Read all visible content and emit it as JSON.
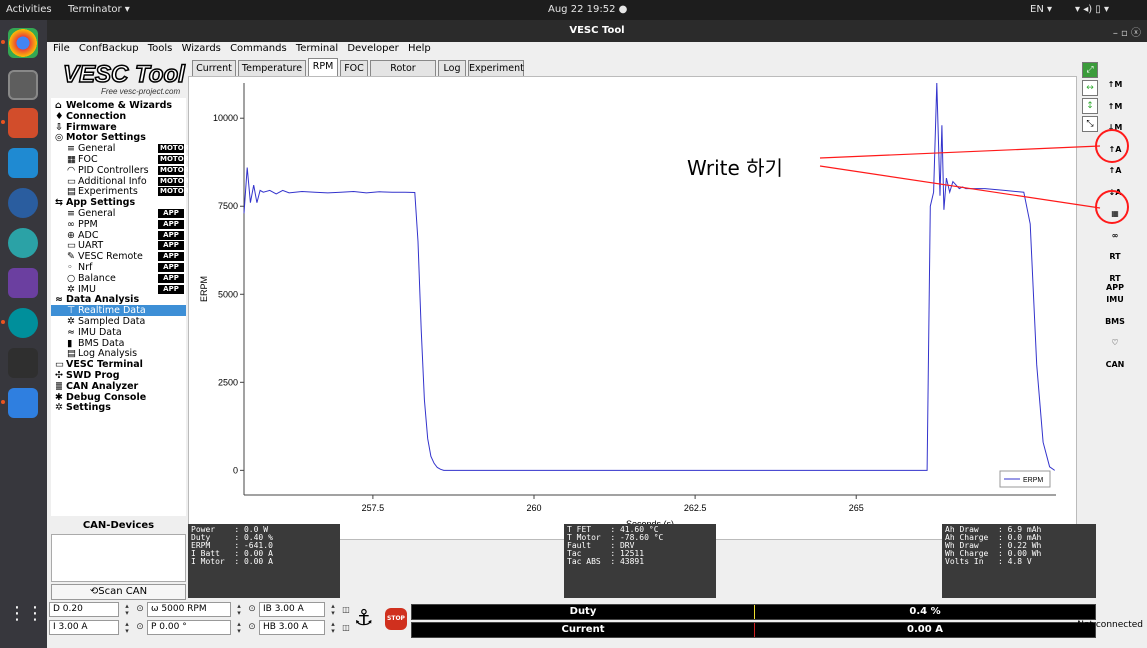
{
  "topbar": {
    "activities": "Activities",
    "app": "Terminator ▾",
    "clock": "Aug 22  19:52  ●",
    "lang": "EN ▾",
    "tray": "▾ ◂) ▯ ▾"
  },
  "window": {
    "title": "VESC Tool",
    "controls": "– ▫ ⓧ"
  },
  "menu": [
    "File",
    "ConfBackup",
    "Tools",
    "Wizards",
    "Commands",
    "Terminal",
    "Developer",
    "Help"
  ],
  "logo": {
    "brand": "VESC Tool",
    "sub": "Free  vesc-project.com"
  },
  "tree": [
    {
      "label": "Welcome & Wizards",
      "icon": "⌂",
      "head": true
    },
    {
      "label": "Connection",
      "icon": "♦",
      "head": true
    },
    {
      "label": "Firmware",
      "icon": "⇩",
      "head": true
    },
    {
      "label": "Motor Settings",
      "icon": "◎",
      "head": true
    },
    {
      "label": "General",
      "icon": "≡",
      "badge": "MOTOR",
      "sub": true
    },
    {
      "label": "FOC",
      "icon": "▦",
      "badge": "MOTOR",
      "sub": true
    },
    {
      "label": "PID Controllers",
      "icon": "◠",
      "badge": "MOTOR",
      "sub": true
    },
    {
      "label": "Additional Info",
      "icon": "▭",
      "badge": "MOTOR",
      "sub": true
    },
    {
      "label": "Experiments",
      "icon": "▤",
      "badge": "MOTOR",
      "sub": true
    },
    {
      "label": "App Settings",
      "icon": "⇆",
      "head": true
    },
    {
      "label": "General",
      "icon": "≡",
      "badge": "APP",
      "sub": true
    },
    {
      "label": "PPM",
      "icon": "∞",
      "badge": "APP",
      "sub": true
    },
    {
      "label": "ADC",
      "icon": "⊕",
      "badge": "APP",
      "sub": true
    },
    {
      "label": "UART",
      "icon": "▭",
      "badge": "APP",
      "sub": true
    },
    {
      "label": "VESC Remote",
      "icon": "✎",
      "badge": "APP",
      "sub": true
    },
    {
      "label": "Nrf",
      "icon": "◦",
      "badge": "APP",
      "sub": true
    },
    {
      "label": "Balance",
      "icon": "○",
      "badge": "APP",
      "sub": true
    },
    {
      "label": "IMU",
      "icon": "✲",
      "badge": "APP",
      "sub": true
    },
    {
      "label": "Data Analysis",
      "icon": "≈",
      "head": true
    },
    {
      "label": "Realtime Data",
      "icon": "⊤",
      "sub": true,
      "selected": true
    },
    {
      "label": "Sampled Data",
      "icon": "✲",
      "sub": true
    },
    {
      "label": "IMU Data",
      "icon": "≈",
      "sub": true
    },
    {
      "label": "BMS Data",
      "icon": "▮",
      "sub": true
    },
    {
      "label": "Log Analysis",
      "icon": "▤",
      "sub": true
    },
    {
      "label": "VESC Terminal",
      "icon": "▭",
      "head": true
    },
    {
      "label": "SWD Prog",
      "icon": "✣",
      "head": true
    },
    {
      "label": "CAN Analyzer",
      "icon": "≣",
      "head": true
    },
    {
      "label": "Debug Console",
      "icon": "✱",
      "head": true
    },
    {
      "label": "Settings",
      "icon": "✲",
      "head": true
    }
  ],
  "can": {
    "title": "CAN-Devices",
    "scan": "⟲Scan CAN"
  },
  "tabs": [
    "Current",
    "Temperature",
    "RPM",
    "FOC",
    "Rotor Position",
    "Log",
    "Experiment"
  ],
  "active_tab": "RPM",
  "chart_data": {
    "type": "line",
    "xlabel": "Seconds (s)",
    "ylabel": "ERPM",
    "xlim": [
      255.5,
      268.1
    ],
    "ylim": [
      -700,
      11000
    ],
    "xticks": [
      "257.5",
      "260",
      "262.5",
      "265"
    ],
    "xtick_values": [
      257.5,
      260,
      262.5,
      265
    ],
    "yticks": [
      "0",
      "2500",
      "5000",
      "7500",
      "10000"
    ],
    "ytick_values": [
      0,
      2500,
      5000,
      7500,
      10000
    ],
    "legend": "top-right bottom",
    "series": [
      {
        "name": "ERPM",
        "color": "#3333cc",
        "x": [
          255.5,
          255.55,
          255.6,
          255.65,
          255.7,
          255.75,
          255.8,
          255.9,
          256.0,
          256.1,
          256.2,
          256.4,
          256.6,
          256.8,
          257.0,
          257.2,
          257.4,
          257.6,
          257.8,
          258.0,
          258.15,
          258.2,
          258.25,
          258.3,
          258.35,
          258.4,
          258.45,
          258.5,
          258.55,
          258.6,
          258.7,
          258.8,
          259.0,
          260.0,
          262.0,
          264.0,
          266.0,
          266.1,
          266.15,
          266.2,
          266.25,
          266.3,
          266.33,
          266.36,
          266.4,
          266.45,
          266.5,
          266.55,
          266.6,
          266.65,
          266.7,
          267.0,
          267.3,
          267.6,
          267.7,
          267.8,
          267.9,
          268.0,
          268.08
        ],
        "y": [
          7300,
          8600,
          7600,
          8100,
          7600,
          7950,
          7900,
          7950,
          7850,
          7950,
          7880,
          7920,
          7900,
          7880,
          7900,
          7920,
          7880,
          7910,
          7900,
          7900,
          7890,
          6500,
          4000,
          2000,
          900,
          400,
          200,
          80,
          30,
          0,
          0,
          0,
          0,
          0,
          0,
          0,
          0,
          0,
          7500,
          7900,
          11100,
          7800,
          9800,
          7400,
          8300,
          7900,
          8200,
          8100,
          8000,
          8050,
          8000,
          8000,
          7950,
          7900,
          7000,
          3000,
          800,
          100,
          0
        ]
      }
    ]
  },
  "stats": {
    "left": "Power    : 0.0 W\nDuty     : 0.40 %\nERPM     : -641.0\nI Batt   : 0.00 A\nI Motor  : 0.00 A",
    "mid": "T FET    : 41.60 °C\nT Motor  : -78.60 °C\nFault    : DRV\nTac      : 12511\nTac ABS  : 43891",
    "right": "Ah Draw    : 6.9 mAh\nAh Charge  : 0.0 mAh\nWh Draw    : 0.22 Wh\nWh Charge  : 0.00 Wh\nVolts In   : 4.8 V"
  },
  "controls": {
    "duty": "D 0.20",
    "speed": "ω 5000 RPM",
    "ib": "IB 3.00 A",
    "current": "I 3.00 A",
    "pos": "P 0.00 °",
    "hb": "HB 3.00 A",
    "stop": "STOP",
    "anchor": "⚓"
  },
  "bars": [
    {
      "label": "Duty",
      "value": "0.4 %",
      "fraction": 0.004
    },
    {
      "label": "Current",
      "value": "0.00 A",
      "fraction": 0.0
    }
  ],
  "status": "Not connected",
  "annotation": {
    "text": "Write 하기",
    "color": "#ff1a1a"
  },
  "right_icons": [
    "↑M",
    "↑M",
    "↓M",
    "↑A",
    "↑A",
    "↓A",
    "▦",
    "∞",
    "RT",
    "RT APP",
    "IMU",
    "BMS",
    "♡",
    "CAN"
  ]
}
